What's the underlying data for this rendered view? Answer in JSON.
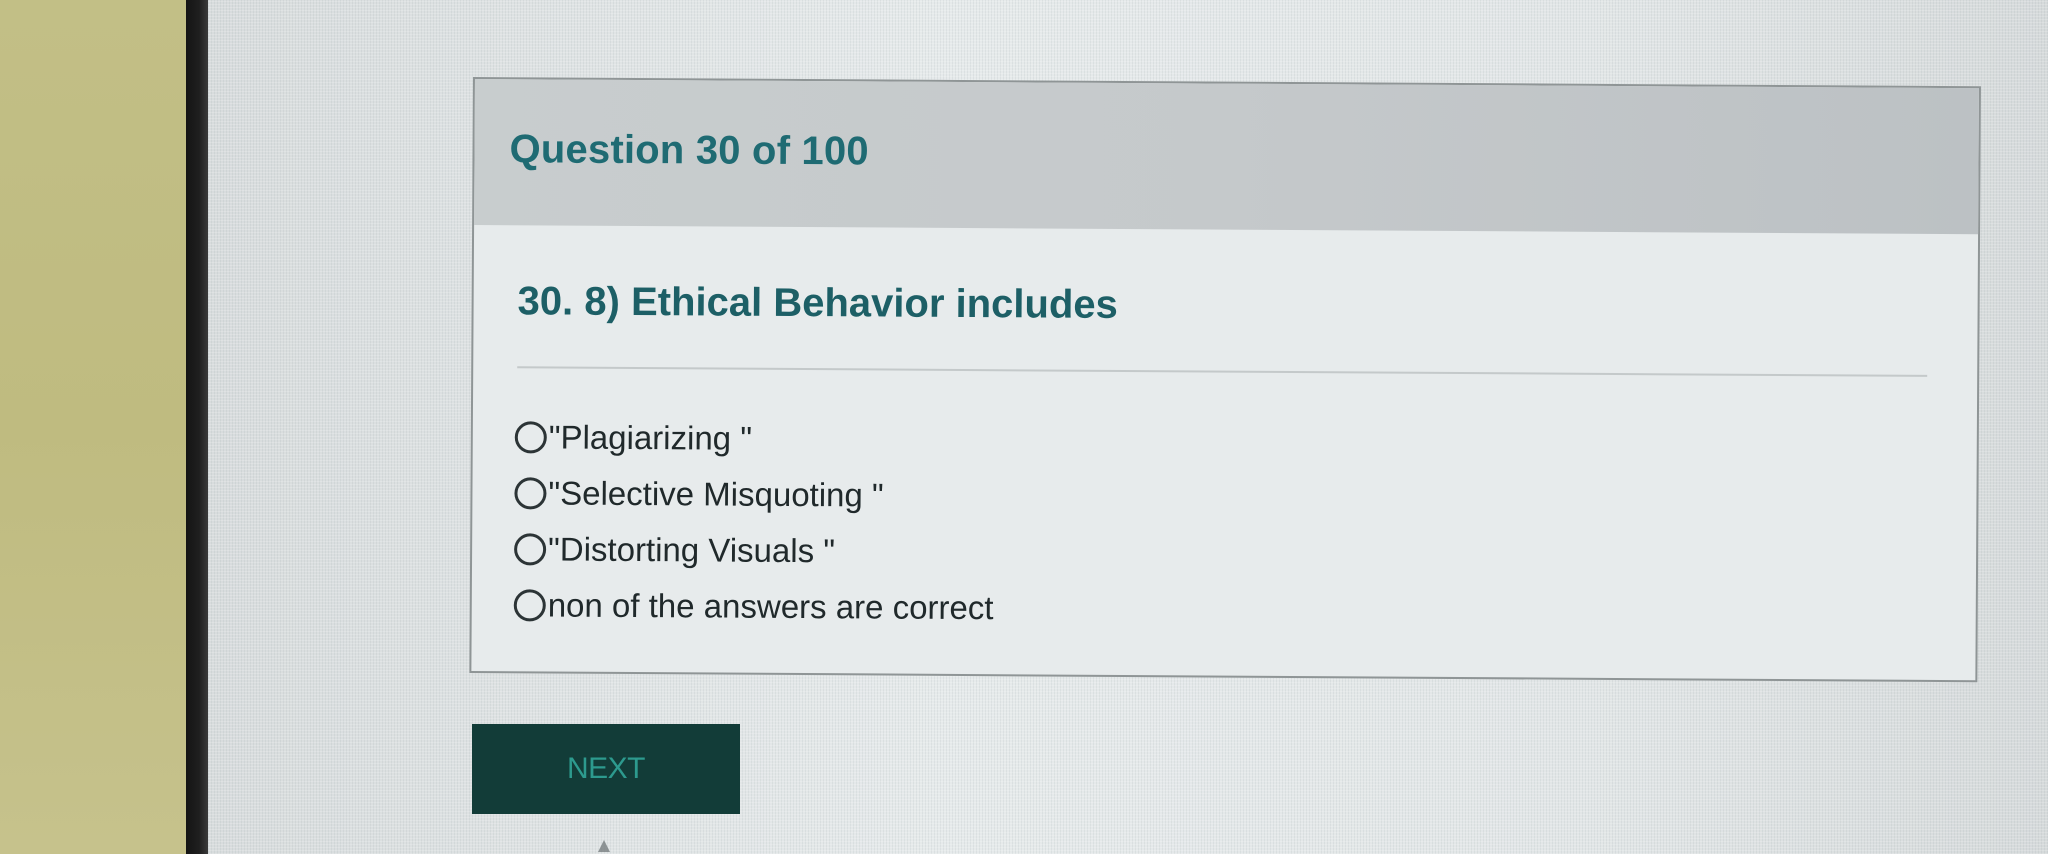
{
  "quiz": {
    "progress_label": "Question 30 of 100",
    "current_question": 30,
    "total_questions": 100,
    "question_text": "30. 8) Ethical Behavior includes",
    "options": [
      {
        "label": "\"Plagiarizing \""
      },
      {
        "label": "\"Selective Misquoting \""
      },
      {
        "label": "\"Distorting Visuals \""
      },
      {
        "label": "non of the answers are correct"
      }
    ]
  },
  "actions": {
    "next_label": "NEXT"
  },
  "colors": {
    "title": "#1f6b73",
    "header_bg": "#c5c9cb",
    "button_bg": "#123c38",
    "button_text": "#2d9a8e"
  }
}
